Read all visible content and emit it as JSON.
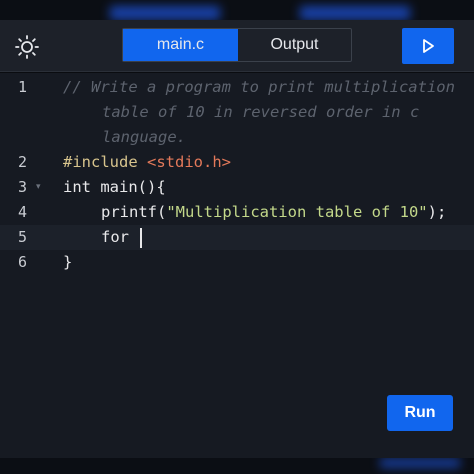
{
  "toolbar": {
    "theme_icon": "sun-icon",
    "tabs": [
      {
        "label": "main.c",
        "active": true
      },
      {
        "label": "Output",
        "active": false
      }
    ],
    "play_icon": "play-icon"
  },
  "editor": {
    "lines": [
      {
        "number": "1",
        "comment": [
          "// Write a program to print multiplication",
          "table of 10 in reversed order in c",
          "language."
        ]
      },
      {
        "number": "2",
        "include": "#include",
        "header": "<stdio.h>"
      },
      {
        "number": "3",
        "code": "int main(){"
      },
      {
        "number": "4",
        "func": "printf(",
        "string": "\"Multiplication table of 10\"",
        "tail": ");"
      },
      {
        "number": "5",
        "code": "for "
      },
      {
        "number": "6",
        "code": "}"
      }
    ]
  },
  "run_button": {
    "label": "Run"
  },
  "colors": {
    "accent": "#1166ee",
    "background": "#161a22",
    "toolbar": "#1d2129"
  }
}
